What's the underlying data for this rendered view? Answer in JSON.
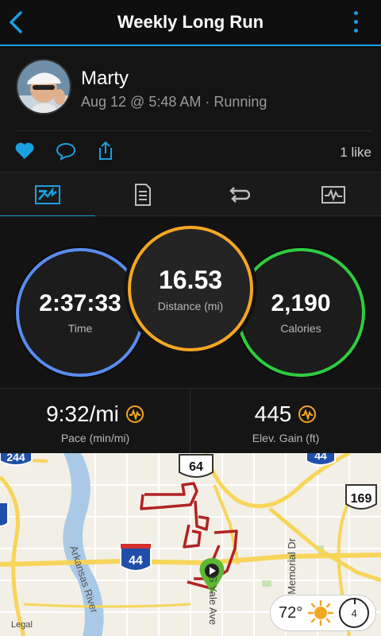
{
  "header": {
    "title": "Weekly Long Run",
    "back_icon": "chevron-left-icon",
    "menu_icon": "kebab-menu-icon"
  },
  "colors": {
    "accent": "#1a9fe0",
    "time_ring": "#5a8cf0",
    "distance_ring": "#f5a623",
    "calories_ring": "#2ecc40",
    "route": "#b22222",
    "pin": "#5cb832"
  },
  "activity": {
    "user_name": "Marty",
    "meta": "Aug 12 @ 5:48 AM · Running",
    "likes": "1 like"
  },
  "tabs": [
    {
      "icon": "stats-card-icon",
      "active": true
    },
    {
      "icon": "details-list-icon",
      "active": false
    },
    {
      "icon": "laps-loop-icon",
      "active": false
    },
    {
      "icon": "chart-graph-icon",
      "active": false
    }
  ],
  "rings": {
    "time": {
      "value": "2:37:33",
      "label": "Time"
    },
    "distance": {
      "value": "16.53",
      "label": "Distance (mi)"
    },
    "calories": {
      "value": "2,190",
      "label": "Calories"
    }
  },
  "stats": {
    "pace": {
      "value": "9:32/mi",
      "label": "Pace (min/mi)"
    },
    "elev": {
      "value": "445",
      "label": "Elev. Gain (ft)"
    }
  },
  "map": {
    "shields": {
      "i244": "244",
      "us64": "64",
      "i44a": "44",
      "us169": "169",
      "i44b": "44",
      "i44c": "44"
    },
    "labels": {
      "river": "Arkansas River",
      "memorial": "S Memorial Dr",
      "yale": "S Yale Ave"
    },
    "legal": "Legal"
  },
  "weather": {
    "temp": "72°",
    "icon": "sun-icon",
    "wind": "4"
  }
}
